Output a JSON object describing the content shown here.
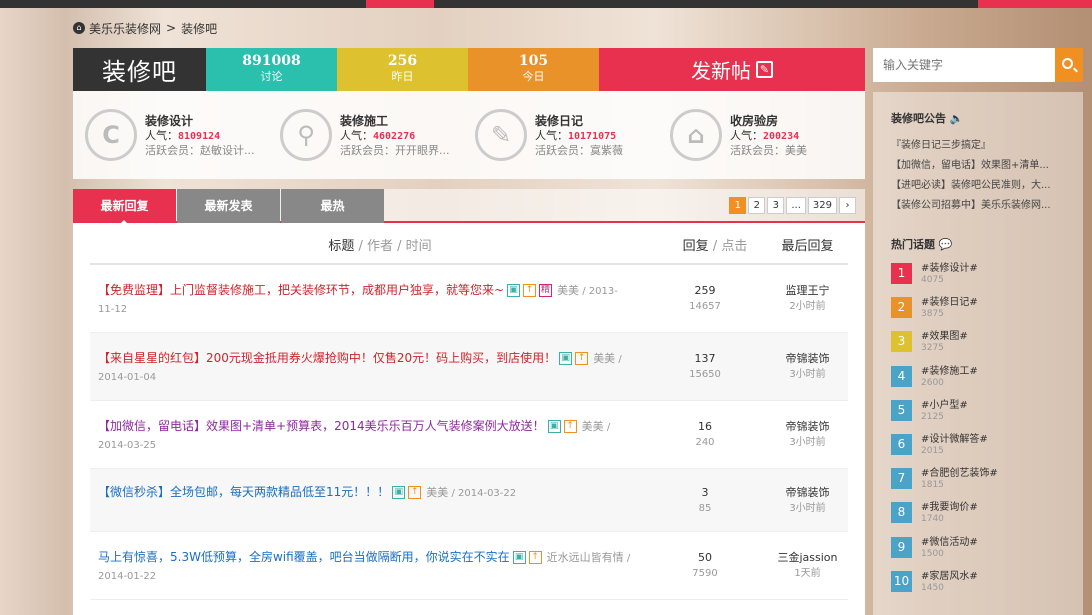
{
  "breadcrumb": {
    "home_icon": "home-icon",
    "site": "美乐乐装修网",
    "sep": ">",
    "current": "装修吧"
  },
  "header": {
    "title": "装修吧",
    "stats": [
      {
        "value": "891008",
        "label": "讨论",
        "color": "#2bbfae"
      },
      {
        "value": "256",
        "label": "昨日",
        "color": "#ddc12e"
      },
      {
        "value": "105",
        "label": "今日",
        "color": "#e9922a"
      }
    ],
    "post_label": "发新帖",
    "post_icon": "edit-icon"
  },
  "categories": [
    {
      "name": "装修设计",
      "icon": "design-icon",
      "popularity_label": "人气：",
      "popularity": "8109124",
      "active_label": "活跃会员：",
      "active": "赵敏设计..."
    },
    {
      "name": "装修施工",
      "icon": "wrench-icon",
      "popularity_label": "人气：",
      "popularity": "4602276",
      "active_label": "活跃会员：",
      "active": "开开眼界..."
    },
    {
      "name": "装修日记",
      "icon": "pen-icon",
      "popularity_label": "人气：",
      "popularity": "10171075",
      "active_label": "活跃会员：",
      "active": "寞紫薇"
    },
    {
      "name": "收房验房",
      "icon": "house-icon",
      "popularity_label": "人气：",
      "popularity": "200234",
      "active_label": "活跃会员：",
      "active": "美美"
    }
  ],
  "tabs": [
    {
      "label": "最新回复"
    },
    {
      "label": "最新发表"
    },
    {
      "label": "最热"
    }
  ],
  "pager": {
    "pages": [
      "1",
      "2",
      "3",
      "...",
      "329"
    ],
    "next": "›"
  },
  "list_header": {
    "title": "标题",
    "sep": " / ",
    "author": "作者",
    "time": "时间",
    "reply": "回复",
    "click": "点击",
    "last": "最后回复"
  },
  "topics": [
    {
      "title": "【免费监理】上门监督装修施工，把关装修环节，成都用户独享，就等您来~",
      "color": "red",
      "badges": [
        "img",
        "up",
        "jing"
      ],
      "author": "美美",
      "date": "2013-11-12",
      "replies": "259",
      "views": "14657",
      "last_user": "监理王宁",
      "last_time": "2小时前"
    },
    {
      "title": "【来自星星的红包】200元现金抵用券火爆抢购中！仅售20元！码上购买，到店使用！",
      "color": "red",
      "badges": [
        "img",
        "up"
      ],
      "author": "美美",
      "date": "2014-01-04",
      "replies": "137",
      "views": "15650",
      "last_user": "帝锦装饰",
      "last_time": "3小时前"
    },
    {
      "title": "【加微信，留电话】效果图+清单+预算表，2014美乐乐百万人气装修案例大放送！",
      "color": "purple",
      "badges": [
        "img",
        "up"
      ],
      "author": "美美",
      "date": "2014-03-25",
      "replies": "16",
      "views": "240",
      "last_user": "帝锦装饰",
      "last_time": "3小时前"
    },
    {
      "title": "【微信秒杀】全场包邮，每天两款精品低至11元！！！",
      "color": "blue",
      "badges": [
        "img",
        "up"
      ],
      "author": "美美",
      "date": "2014-03-22",
      "replies": "3",
      "views": "85",
      "last_user": "帝锦装饰",
      "last_time": "3小时前"
    },
    {
      "title": "马上有惊喜，5.3W低预算，全房wifi覆盖，吧台当做隔断用，你说实在不实在",
      "color": "blue",
      "badges": [
        "img",
        "up"
      ],
      "author": "近水远山皆有情",
      "date": "2014-01-22",
      "replies": "50",
      "views": "7590",
      "last_user": "三金jassion",
      "last_time": "1天前"
    }
  ],
  "search": {
    "placeholder": "输入关键字",
    "icon": "search-icon"
  },
  "notice": {
    "title": "装修吧公告",
    "icon": "speaker-icon",
    "items": [
      "『装修日记三步搞定』",
      "【加微信，留电话】效果图+清单...",
      "【进吧必读】装修吧公民准则，大...",
      "【装修公司招募中】美乐乐装修网..."
    ]
  },
  "hot": {
    "title": "热门话题",
    "icon": "chat-icon",
    "items": [
      {
        "rank": "1",
        "name": "#装修设计#",
        "count": "4075",
        "color": "#e8304f"
      },
      {
        "rank": "2",
        "name": "#装修日记#",
        "count": "3875",
        "color": "#e9922a"
      },
      {
        "rank": "3",
        "name": "#效果图#",
        "count": "3275",
        "color": "#ddc12e"
      },
      {
        "rank": "4",
        "name": "#装修施工#",
        "count": "2600",
        "color": "#4ba3c8"
      },
      {
        "rank": "5",
        "name": "#小户型#",
        "count": "2125",
        "color": "#4ba3c8"
      },
      {
        "rank": "6",
        "name": "#设计微解答#",
        "count": "2015",
        "color": "#4ba3c8"
      },
      {
        "rank": "7",
        "name": "#合肥创艺装饰#",
        "count": "1815",
        "color": "#4ba3c8"
      },
      {
        "rank": "8",
        "name": "#我要询价#",
        "count": "1740",
        "color": "#4ba3c8"
      },
      {
        "rank": "9",
        "name": "#微信活动#",
        "count": "1500",
        "color": "#4ba3c8"
      },
      {
        "rank": "10",
        "name": "#家居风水#",
        "count": "1450",
        "color": "#4ba3c8"
      }
    ]
  }
}
